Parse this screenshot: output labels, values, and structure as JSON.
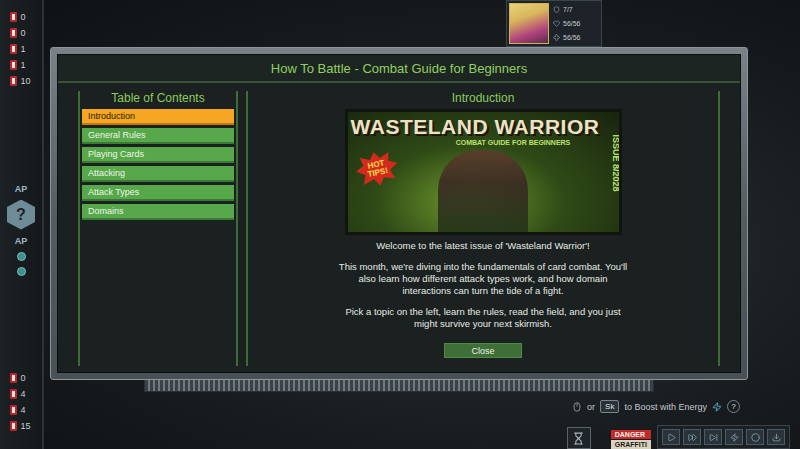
{
  "hud": {
    "top_counts": [
      "0",
      "0",
      "1",
      "1",
      "10"
    ],
    "ap_labels": [
      "AP",
      "AP"
    ],
    "ap_button": "?",
    "bottom_counts": [
      "0",
      "4",
      "4",
      "15"
    ],
    "portrait_stats": [
      "7/7",
      "56/56",
      "56/56"
    ],
    "hint": {
      "or": "or",
      "key": "Sk",
      "text": "to Boost with Energy",
      "help": "?"
    },
    "signs": [
      "DANGER",
      "GRAFFITI"
    ]
  },
  "dialog": {
    "title": "How To Battle - Combat Guide for Beginners",
    "toc": {
      "heading": "Table of Contents",
      "items": [
        {
          "label": "Introduction",
          "selected": true
        },
        {
          "label": "General Rules",
          "selected": false
        },
        {
          "label": "Playing Cards",
          "selected": false
        },
        {
          "label": "Attacking",
          "selected": false
        },
        {
          "label": "Attack Types",
          "selected": false
        },
        {
          "label": "Domains",
          "selected": false
        }
      ]
    },
    "content": {
      "heading": "Introduction",
      "cover": {
        "title": "WASTELAND WARRIOR",
        "subtitle": "COMBAT GUIDE FOR BEGINNERS",
        "issue": "ISSUE 8/2028",
        "badge": "HOT TIPS!"
      },
      "paragraphs": [
        "Welcome to the latest issue of 'Wasteland Warrior'!",
        "This month, we're diving into the fundamentals of card combat. You'll also learn how different attack types work, and how domain interactions can turn the tide of a fight.",
        "Pick a topic on the left, learn the rules, read the field, and you just might survive your next skirmish."
      ]
    },
    "close_button": "Close"
  }
}
